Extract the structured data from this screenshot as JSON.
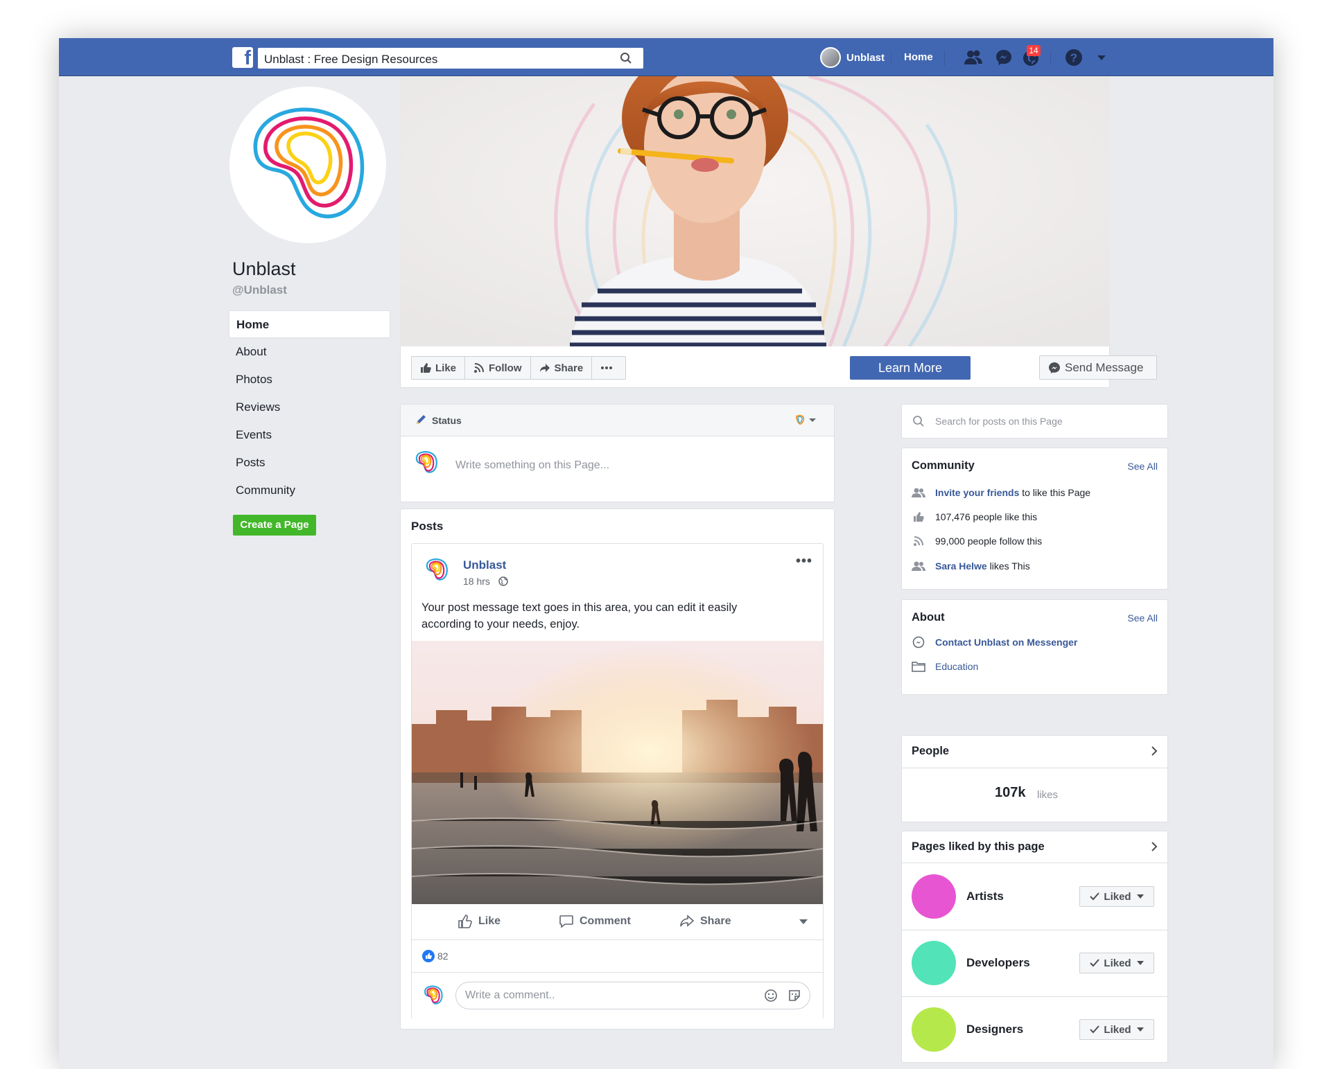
{
  "topbar": {
    "search_text": "Unblast : Free Design Resources",
    "user_name": "Unblast",
    "home_label": "Home",
    "notification_count": "14",
    "brand_color": "#4267b2"
  },
  "page": {
    "name": "Unblast",
    "handle": "@Unblast"
  },
  "left_nav": {
    "items": [
      "Home",
      "About",
      "Photos",
      "Reviews",
      "Events",
      "Posts",
      "Community"
    ],
    "create_page_label": "Create a Page"
  },
  "actions": {
    "like": "Like",
    "follow": "Follow",
    "share": "Share",
    "learn_more": "Learn More",
    "send_message": "Send Message"
  },
  "composer": {
    "status_label": "Status",
    "placeholder": "Write something on this Page..."
  },
  "posts": {
    "title": "Posts",
    "post": {
      "author": "Unblast",
      "time": "18 hrs",
      "text": "Your post message text goes in this area, you can edit it easily according to your needs, enjoy.",
      "like_label": "Like",
      "comment_label": "Comment",
      "share_label": "Share",
      "reaction_count": "82",
      "comment_placeholder": "Write a comment.."
    }
  },
  "sidebar": {
    "search_placeholder": "Search for posts on this Page",
    "community": {
      "title": "Community",
      "see_all": "See All",
      "invite_link": "Invite your friends",
      "invite_suffix": " to like this Page",
      "likes": "107,476 people like this",
      "follows": "99,000 people follow this",
      "friend_name": "Sara Helwe",
      "friend_suffix": " likes This"
    },
    "about": {
      "title": "About",
      "see_all": "See All",
      "messenger": "Contact Unblast on Messenger",
      "education": "Education"
    },
    "people": {
      "title": "People",
      "count": "107k",
      "count_label": "likes"
    },
    "pages_liked": {
      "title": "Pages liked by this page",
      "items": [
        {
          "name": "Artists",
          "button": "Liked",
          "color": "#e855d2"
        },
        {
          "name": "Developers",
          "button": "Liked",
          "color": "#52e3b8"
        },
        {
          "name": "Designers",
          "button": "Liked",
          "color": "#b5e84a"
        }
      ]
    }
  }
}
